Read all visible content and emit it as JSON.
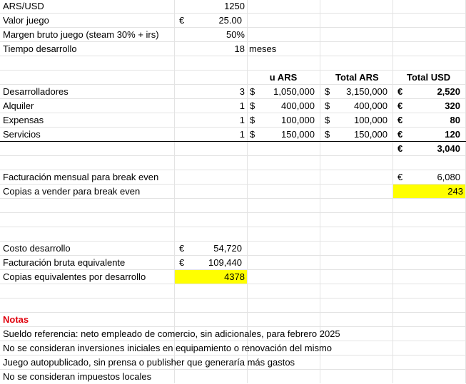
{
  "params": [
    {
      "label": "ARS/USD",
      "currency": "",
      "value": "1250",
      "unit": ""
    },
    {
      "label": "Valor juego",
      "currency": "€",
      "value": "25.00",
      "unit": ""
    },
    {
      "label": "Margen bruto juego (steam 30% + irs)",
      "currency": "",
      "value": "50%",
      "unit": ""
    },
    {
      "label": "Tiempo desarrollo",
      "currency": "",
      "value": "18",
      "unit": "meses"
    }
  ],
  "cost_table": {
    "headers": {
      "u_ars": "u ARS",
      "total_ars": "Total ARS",
      "total_usd": "Total USD"
    },
    "rows": [
      {
        "label": "Desarrolladores",
        "qty": "3",
        "cur1": "$",
        "u_ars": "1,050,000",
        "cur2": "$",
        "total_ars": "3,150,000",
        "cur3": "€",
        "total_usd": "2,520"
      },
      {
        "label": "Alquiler",
        "qty": "1",
        "cur1": "$",
        "u_ars": "400,000",
        "cur2": "$",
        "total_ars": "400,000",
        "cur3": "€",
        "total_usd": "320"
      },
      {
        "label": "Expensas",
        "qty": "1",
        "cur1": "$",
        "u_ars": "100,000",
        "cur2": "$",
        "total_ars": "100,000",
        "cur3": "€",
        "total_usd": "80"
      },
      {
        "label": "Servicios",
        "qty": "1",
        "cur1": "$",
        "u_ars": "150,000",
        "cur2": "$",
        "total_ars": "150,000",
        "cur3": "€",
        "total_usd": "120"
      }
    ],
    "total": {
      "cur": "€",
      "value": "3,040"
    }
  },
  "breakeven": {
    "monthly_label": "Facturación mensual para break even",
    "monthly_cur": "€",
    "monthly_value": "6,080",
    "copies_label": "Copias a vender para break even",
    "copies_value": "243"
  },
  "development": [
    {
      "label": "Costo desarrollo",
      "cur": "€",
      "value": "54,720"
    },
    {
      "label": "Facturación bruta equivalente",
      "cur": "€",
      "value": "109,440"
    },
    {
      "label": "Copias equivalentes por desarrollo",
      "cur": "",
      "value": "4378"
    }
  ],
  "notes": {
    "title": "Notas",
    "items": [
      "Sueldo referencia: neto empleado de comercio, sin adicionales, para febrero 2025",
      "No se consideran inversiones iniciales en equipamiento o renovación del mismo",
      "Juego autopublicado, sin prensa o publisher que generaría más gastos",
      "No se consideran impuestos locales"
    ]
  },
  "colors": {
    "highlight": "#ffff00",
    "notes_title": "#e0000c",
    "gridline": "#e3e3e3"
  }
}
